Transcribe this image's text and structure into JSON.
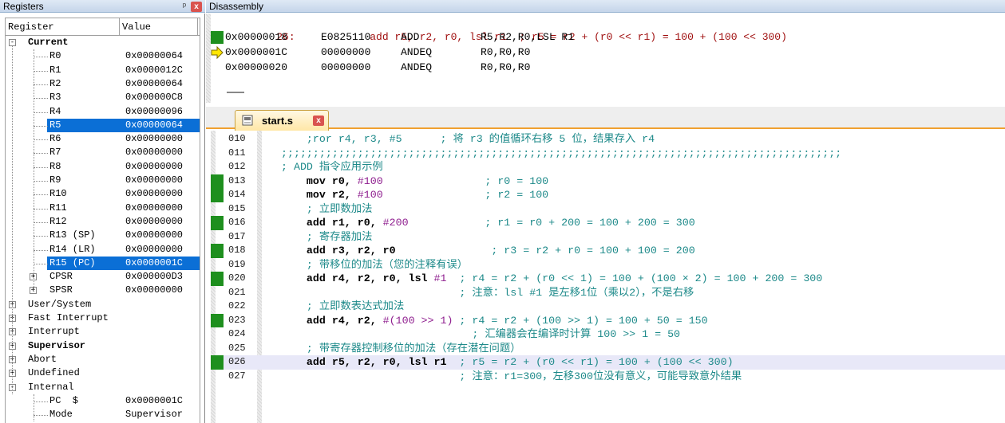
{
  "registers_panel": {
    "title": "Registers",
    "pin_glyph": "ᵖ",
    "close_glyph": "x",
    "columns": {
      "register": "Register",
      "value": "Value"
    },
    "current_label": "Current",
    "rows": [
      {
        "name": "R0",
        "value": "0x00000064"
      },
      {
        "name": "R1",
        "value": "0x0000012C"
      },
      {
        "name": "R2",
        "value": "0x00000064"
      },
      {
        "name": "R3",
        "value": "0x000000C8"
      },
      {
        "name": "R4",
        "value": "0x00000096"
      },
      {
        "name": "R5",
        "value": "0x00000064",
        "selected": true
      },
      {
        "name": "R6",
        "value": "0x00000000"
      },
      {
        "name": "R7",
        "value": "0x00000000"
      },
      {
        "name": "R8",
        "value": "0x00000000"
      },
      {
        "name": "R9",
        "value": "0x00000000"
      },
      {
        "name": "R10",
        "value": "0x00000000"
      },
      {
        "name": "R11",
        "value": "0x00000000"
      },
      {
        "name": "R12",
        "value": "0x00000000"
      },
      {
        "name": "R13 (SP)",
        "value": "0x00000000"
      },
      {
        "name": "R14 (LR)",
        "value": "0x00000000"
      },
      {
        "name": "R15 (PC)",
        "value": "0x0000001C",
        "selected": true
      },
      {
        "name": "CPSR",
        "value": "0x000000D3",
        "expandable": true
      },
      {
        "name": "SPSR",
        "value": "0x00000000",
        "expandable": true
      }
    ],
    "groups": [
      {
        "name": "User/System",
        "bold": false
      },
      {
        "name": "Fast Interrupt",
        "bold": false
      },
      {
        "name": "Interrupt",
        "bold": false
      },
      {
        "name": "Supervisor",
        "bold": true
      },
      {
        "name": "Abort",
        "bold": false
      },
      {
        "name": "Undefined",
        "bold": false
      }
    ],
    "internal": {
      "name": "Internal",
      "rows": [
        {
          "name": "PC  $",
          "value": "0x0000001C"
        },
        {
          "name": "Mode",
          "value": "Supervisor"
        }
      ]
    }
  },
  "disassembly_panel": {
    "title": "Disassembly",
    "source_line": {
      "number": "26:",
      "code": "add r5, r2, r0, lsl r1  ; r5 = r2 + (r0 << r1) = 100 + (100 << 300)"
    },
    "rows": [
      {
        "addr": "0x00000018",
        "opcode": "E0825110",
        "mnemonic": "ADD",
        "operands": "R5,R2,R0,LSL R1",
        "marker": "breakpoint"
      },
      {
        "addr": "0x0000001C",
        "opcode": "00000000",
        "mnemonic": "ANDEQ",
        "operands": "R0,R0,R0",
        "marker": "pc-arrow"
      },
      {
        "addr": "0x00000020",
        "opcode": "00000000",
        "mnemonic": "ANDEQ",
        "operands": "R0,R0,R0",
        "marker": "none"
      }
    ]
  },
  "editor": {
    "tab_label": "start.s",
    "tab_close_glyph": "x",
    "lines": [
      {
        "num": "010",
        "bp": false,
        "cur": false,
        "parts": [
          [
            "cm",
            "    ;ror r4, r3, #5      ; 将 r3 的值循环右移 5 位，结果存入 r4"
          ]
        ]
      },
      {
        "num": "011",
        "bp": false,
        "cur": false,
        "parts": [
          [
            "cm",
            ";;;;;;;;;;;;;;;;;;;;;;;;;;;;;;;;;;;;;;;;;;;;;;;;;;;;;;;;;;;;;;;;;;;;;;;;;;;;;;;;;;;;;;;;"
          ]
        ]
      },
      {
        "num": "012",
        "bp": false,
        "cur": false,
        "parts": [
          [
            "cm",
            "; ADD 指令应用示例"
          ]
        ]
      },
      {
        "num": "013",
        "bp": true,
        "cur": false,
        "parts": [
          [
            "kw",
            "    mov r0, "
          ],
          [
            "num",
            "#100"
          ],
          [
            "cm",
            "                ; r0 = 100"
          ]
        ]
      },
      {
        "num": "014",
        "bp": true,
        "cur": false,
        "parts": [
          [
            "kw",
            "    mov r2, "
          ],
          [
            "num",
            "#100"
          ],
          [
            "cm",
            "                ; r2 = 100"
          ]
        ]
      },
      {
        "num": "015",
        "bp": false,
        "cur": false,
        "parts": [
          [
            "cm",
            "    ; 立即数加法"
          ]
        ]
      },
      {
        "num": "016",
        "bp": true,
        "cur": false,
        "parts": [
          [
            "kw",
            "    add r1, r0, "
          ],
          [
            "num",
            "#200"
          ],
          [
            "cm",
            "            ; r1 = r0 + 200 = 100 + 200 = 300"
          ]
        ]
      },
      {
        "num": "017",
        "bp": false,
        "cur": false,
        "parts": [
          [
            "cm",
            "    ; 寄存器加法"
          ]
        ]
      },
      {
        "num": "018",
        "bp": true,
        "cur": false,
        "parts": [
          [
            "kw",
            "    add r3, r2, r0"
          ],
          [
            "cm",
            "               ; r3 = r2 + r0 = 100 + 100 = 200"
          ]
        ]
      },
      {
        "num": "019",
        "bp": false,
        "cur": false,
        "parts": [
          [
            "cm",
            "    ; 带移位的加法（您的注释有误）"
          ]
        ]
      },
      {
        "num": "020",
        "bp": true,
        "cur": false,
        "parts": [
          [
            "kw",
            "    add r4, r2, r0, lsl "
          ],
          [
            "num",
            "#1"
          ],
          [
            "cm",
            "  ; r4 = r2 + (r0 << 1) = 100 + (100 × 2) = 100 + 200 = 300"
          ]
        ]
      },
      {
        "num": "021",
        "bp": false,
        "cur": false,
        "parts": [
          [
            "cm",
            "                            ; 注意：lsl #1 是左移1位（乘以2），不是右移"
          ]
        ]
      },
      {
        "num": "022",
        "bp": false,
        "cur": false,
        "parts": [
          [
            "cm",
            "    ; 立即数表达式加法"
          ]
        ]
      },
      {
        "num": "023",
        "bp": true,
        "cur": false,
        "parts": [
          [
            "kw",
            "    add r4, r2, "
          ],
          [
            "num",
            "#(100 >> 1)"
          ],
          [
            "cm",
            " ; r4 = r2 + (100 >> 1) = 100 + 50 = 150"
          ]
        ]
      },
      {
        "num": "024",
        "bp": false,
        "cur": false,
        "parts": [
          [
            "cm",
            "                              ; 汇编器会在编译时计算 100 >> 1 = 50"
          ]
        ]
      },
      {
        "num": "025",
        "bp": false,
        "cur": false,
        "parts": [
          [
            "cm",
            "    ; 带寄存器控制移位的加法（存在潜在问题）"
          ]
        ]
      },
      {
        "num": "026",
        "bp": true,
        "cur": true,
        "parts": [
          [
            "kw",
            "    add r5, r2, r0, lsl r1"
          ],
          [
            "cm",
            "  ; r5 = r2 + (r0 << r1) = 100 + (100 << 300)"
          ]
        ]
      },
      {
        "num": "027",
        "bp": false,
        "cur": false,
        "parts": [
          [
            "cm",
            "                            ; 注意：r1=300，左移300位没有意义，可能导致意外结果"
          ]
        ]
      }
    ]
  },
  "colors": {
    "selection": "#0b6fd6",
    "breakpoint": "#1e8f1e",
    "comment": "#1e8a8a",
    "number": "#8f1f8f",
    "tab_accent": "#f0a030"
  }
}
